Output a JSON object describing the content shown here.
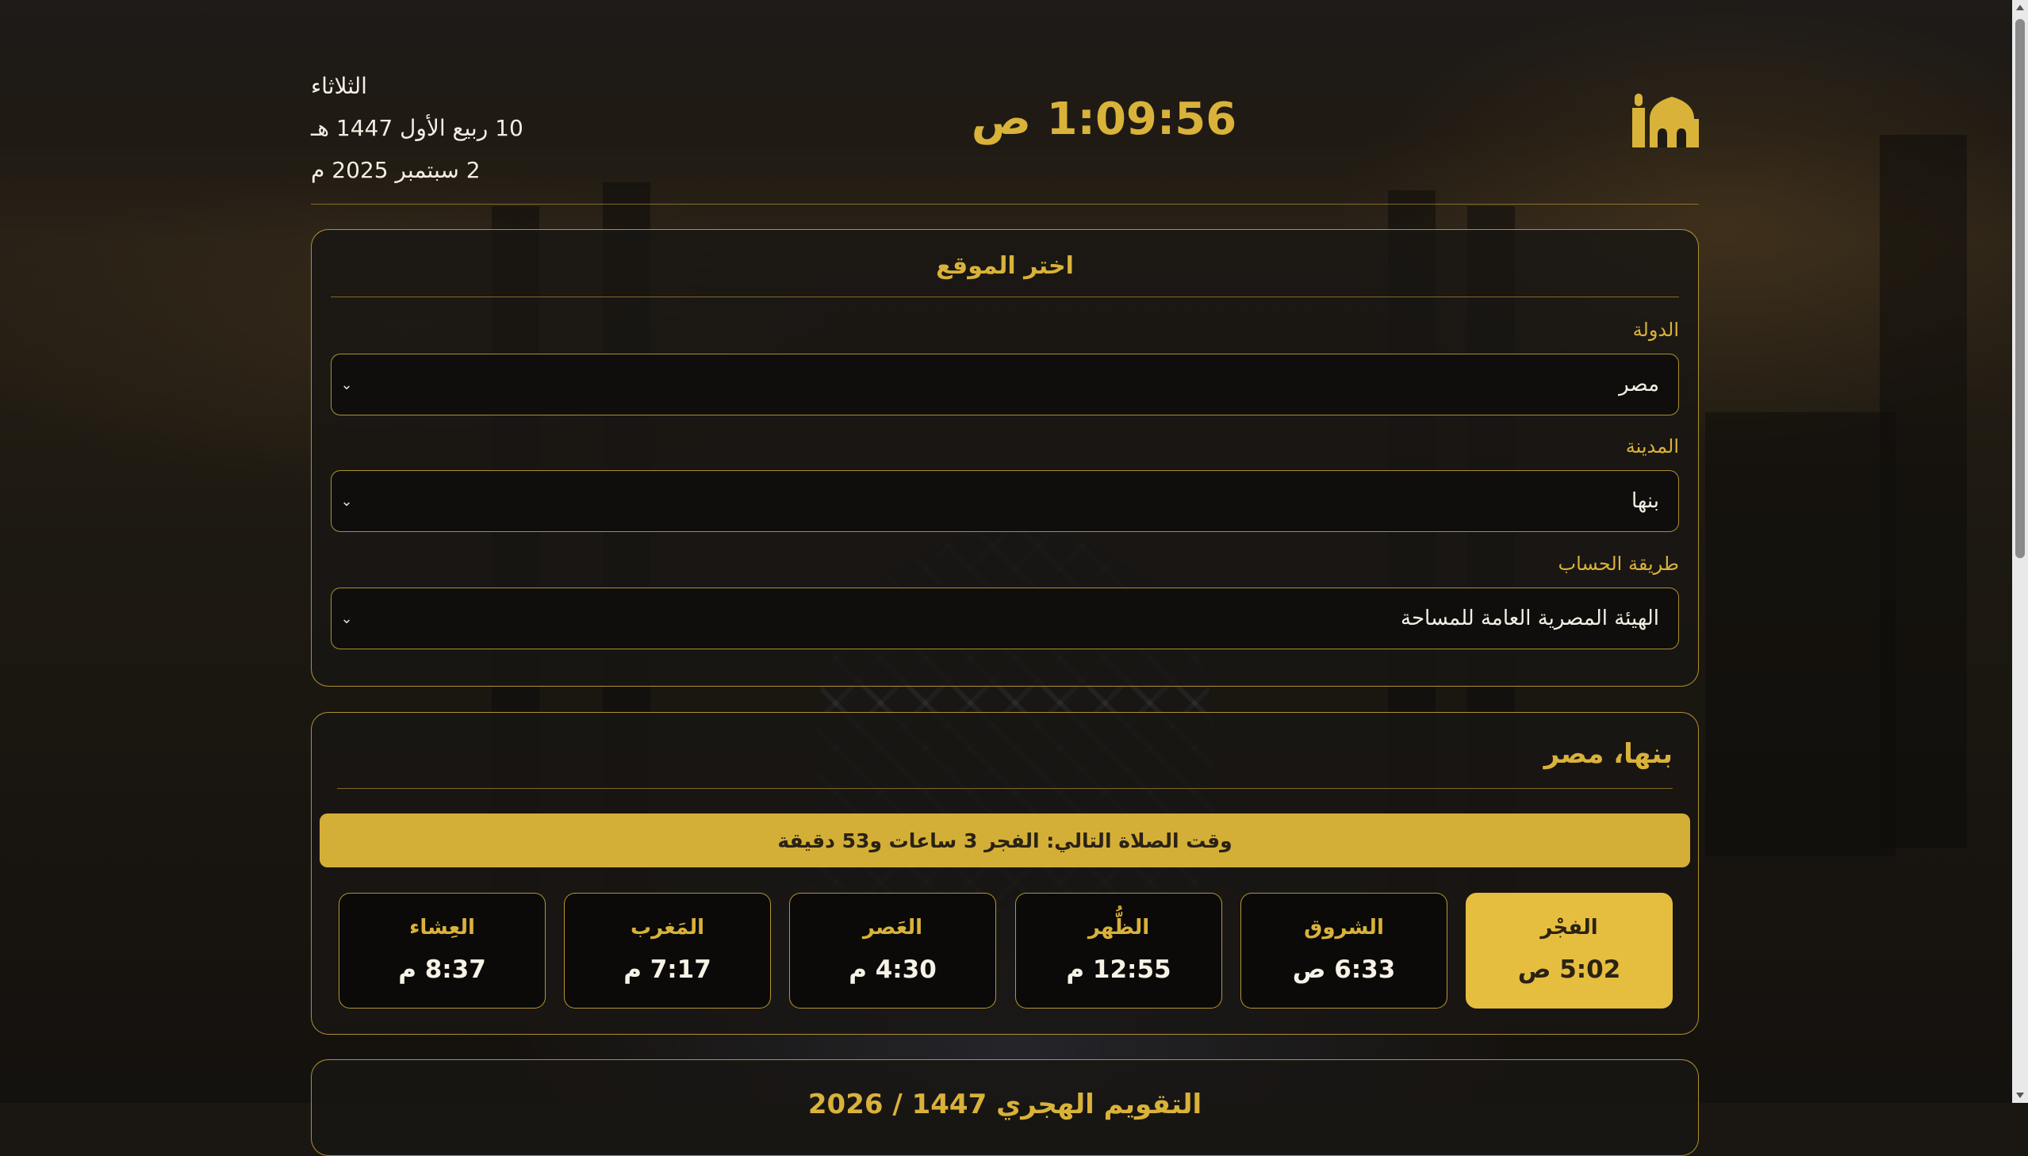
{
  "header": {
    "clock": "1:09:56 ص",
    "day_name": "الثلاثاء",
    "hijri_date": "10 ربيع الأول 1447 هـ",
    "gregorian_date": "2 سبتمبر 2025 م",
    "logo_icon": "mosque-icon"
  },
  "location": {
    "title": "اختر الموقع",
    "country_label": "الدولة",
    "country_value": "مصر",
    "city_label": "المدينة",
    "city_value": "بنها",
    "method_label": "طريقة الحساب",
    "method_value": "الهيئة المصرية العامة للمساحة",
    "chevron_icon": "chevron-down-icon"
  },
  "prayers": {
    "city_title": "بنها، مصر",
    "next_prayer": "وقت الصلاة التالي: الفجر 3 ساعات و53 دقيقة",
    "items": [
      {
        "name": "الفجْر",
        "time": "5:02 ص",
        "active": true
      },
      {
        "name": "الشروق",
        "time": "6:33 ص",
        "active": false
      },
      {
        "name": "الظُّهر",
        "time": "12:55 م",
        "active": false
      },
      {
        "name": "العَصر",
        "time": "4:30 م",
        "active": false
      },
      {
        "name": "المَغرب",
        "time": "7:17 م",
        "active": false
      },
      {
        "name": "العِشاء",
        "time": "8:37 م",
        "active": false
      }
    ]
  },
  "next_section": {
    "title": "التقويم الهجري 1447 / 2026"
  },
  "colors": {
    "accent": "#d4af37",
    "accent_text": "#d9b23a",
    "background": "#1a1611"
  }
}
